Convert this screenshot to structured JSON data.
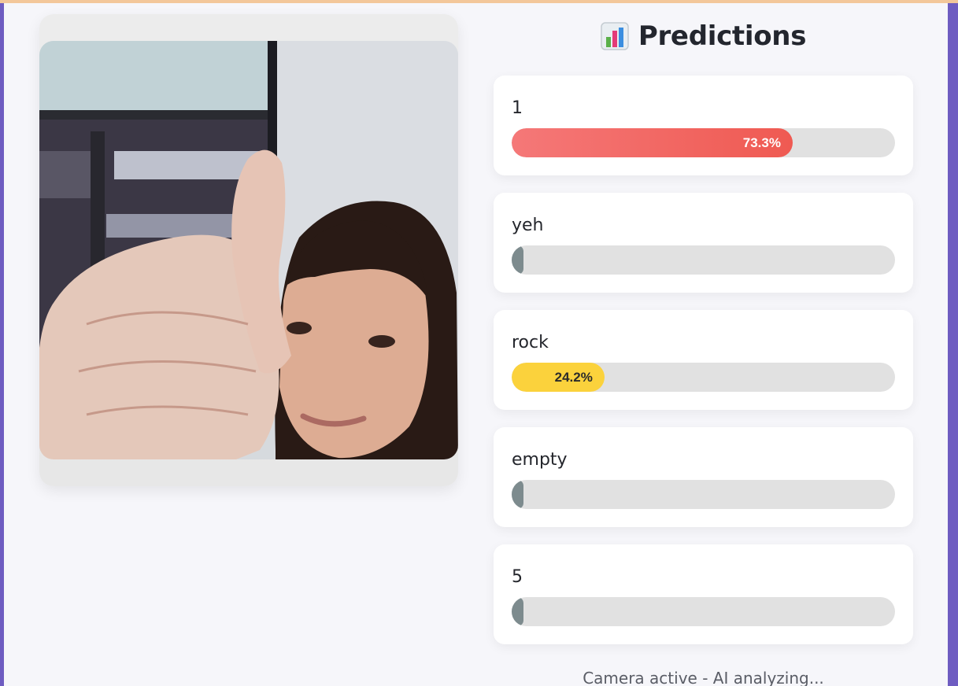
{
  "title": "Predictions",
  "icons": {
    "title_icon": "bar-chart-icon"
  },
  "camera": {
    "image": "webcam-feed-person-thumbs-up"
  },
  "predictions": [
    {
      "label": "1",
      "value": 0.733,
      "percent_text": "73.3%",
      "color_start": "#f57878",
      "color_end": "#ef5a52",
      "text_color": "#ffffff"
    },
    {
      "label": "yeh",
      "value": 0.0,
      "percent_text": "",
      "color_start": "#7d8b8e",
      "color_end": "#7d8b8e",
      "text_color": "#ffffff"
    },
    {
      "label": "rock",
      "value": 0.242,
      "percent_text": "24.2%",
      "color_start": "#fbd23c",
      "color_end": "#fbd23c",
      "text_color": "#2b2b2b"
    },
    {
      "label": "empty",
      "value": 0.0,
      "percent_text": "",
      "color_start": "#7d8b8e",
      "color_end": "#7d8b8e",
      "text_color": "#ffffff"
    },
    {
      "label": "5",
      "value": 0.0,
      "percent_text": "",
      "color_start": "#7d8b8e",
      "color_end": "#7d8b8e",
      "text_color": "#ffffff"
    }
  ],
  "status": "Camera active - AI analyzing..."
}
